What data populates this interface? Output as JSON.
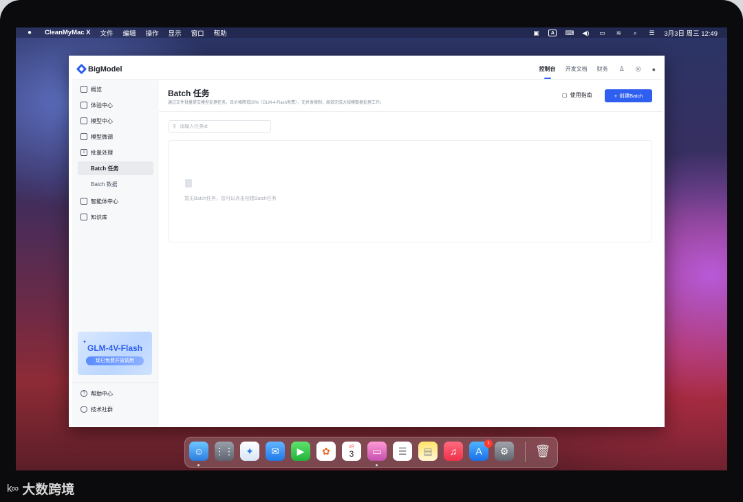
{
  "menubar": {
    "app_name": "CleanMyMac X",
    "items": [
      "文件",
      "编辑",
      "操作",
      "显示",
      "窗口",
      "帮助"
    ],
    "input_method": "A",
    "datetime": "3月3日 周三  12:49"
  },
  "header": {
    "logo_text": "BigModel",
    "nav": [
      "控制台",
      "开发文档",
      "财务"
    ]
  },
  "sidebar": {
    "items": [
      {
        "label": "概览"
      },
      {
        "label": "体验中心"
      },
      {
        "label": "模型中心"
      },
      {
        "label": "模型微调"
      },
      {
        "label": "批量处理"
      },
      {
        "label": "Batch 任务"
      },
      {
        "label": "Batch 数据"
      },
      {
        "label": "智能体中心"
      },
      {
        "label": "知识库"
      }
    ],
    "promo": {
      "title": "GLM-4V-Flash",
      "pill": "现已免费开放调用"
    },
    "footer": [
      {
        "label": "帮助中心"
      },
      {
        "label": "技术社群"
      }
    ]
  },
  "main": {
    "title": "Batch 任务",
    "description": "通过文件批量提交模型处理任务，且价格降低50%（GLM-4-Flash免费），无并发限制，高效完成大规模数据处理工作。",
    "guide_label": "使用指南",
    "create_label": "创建Batch",
    "search_placeholder": "请输入任务id",
    "empty_text": "暂无Batch任务，您可以点击创建Batch任务"
  },
  "dock": {
    "calendar_month": "3月",
    "calendar_day": "3",
    "appstore_badge": "1"
  },
  "watermark": {
    "logo": "k∞",
    "text": "大数跨境"
  },
  "colors": {
    "accent": "#2e5ff0",
    "sidebar_bg": "#f7f8fa"
  }
}
